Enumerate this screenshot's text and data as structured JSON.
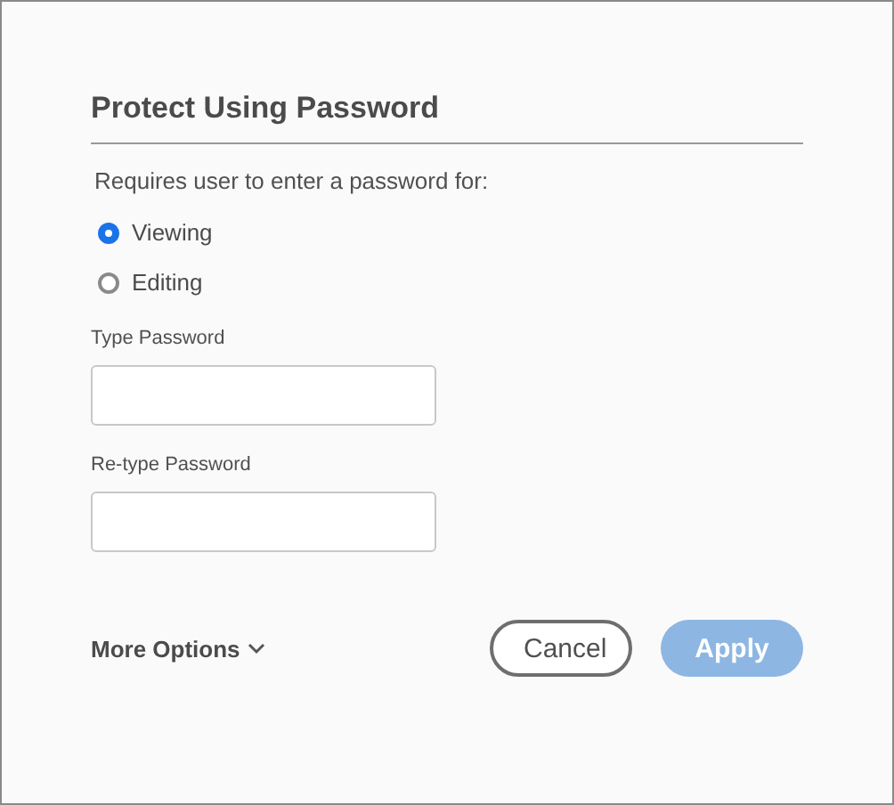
{
  "dialog": {
    "title": "Protect Using Password",
    "prompt": "Requires user to enter a password for:",
    "options": [
      {
        "label": "Viewing",
        "selected": true
      },
      {
        "label": "Editing",
        "selected": false
      }
    ],
    "fields": [
      {
        "label": "Type Password"
      },
      {
        "label": "Re-type Password"
      }
    ],
    "more_options": {
      "label": "More Options",
      "expanded": false
    },
    "buttons": [
      {
        "label": "Cancel",
        "kind": "secondary",
        "disabled": false
      },
      {
        "label": "Apply",
        "kind": "primary",
        "disabled": true
      }
    ]
  }
}
